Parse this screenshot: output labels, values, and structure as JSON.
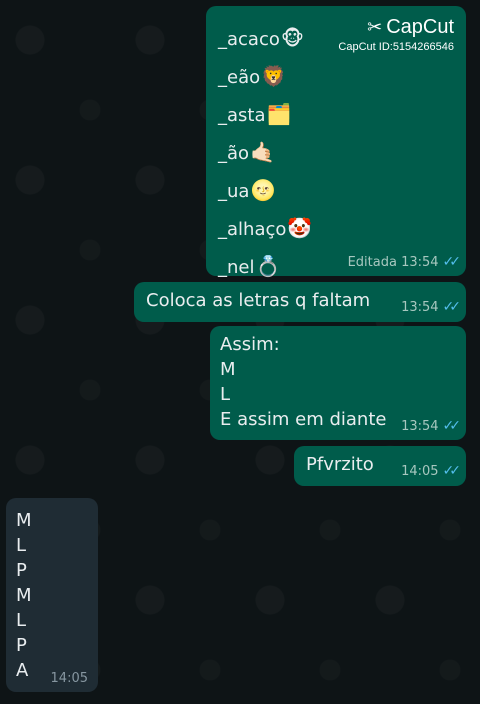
{
  "watermark": {
    "brand": "CapCut",
    "id": "CapCut ID:5154266546",
    "icon": "capcut-logo-icon"
  },
  "messages": {
    "puzzle": {
      "lines": [
        {
          "text": "_acaco",
          "emoji": "🐵"
        },
        {
          "text": "_eão",
          "emoji": "🦁"
        },
        {
          "text": "_asta",
          "emoji": "🗂️"
        },
        {
          "text": "_ão",
          "emoji": "🤙🏻"
        },
        {
          "text": "_ua",
          "emoji": "🌝"
        },
        {
          "text": "_alhaço",
          "emoji": "🤡"
        },
        {
          "text": "_nel",
          "emoji": "💍"
        }
      ],
      "edited_label": "Editada",
      "time": "13:54",
      "ticks": "✓✓"
    },
    "instruction": {
      "text": "Coloca as letras q faltam",
      "time": "13:54",
      "ticks": "✓✓"
    },
    "example": {
      "lines": [
        "Assim:",
        "M",
        "L",
        "E assim em diante"
      ],
      "time": "13:54",
      "ticks": "✓✓"
    },
    "reply_short": {
      "text": "Pfvrzito",
      "time": "14:05",
      "ticks": "✓✓"
    },
    "incoming": {
      "letters": [
        "M",
        "L",
        "P",
        "M",
        "L",
        "P",
        "A"
      ],
      "time": "14:05"
    }
  }
}
